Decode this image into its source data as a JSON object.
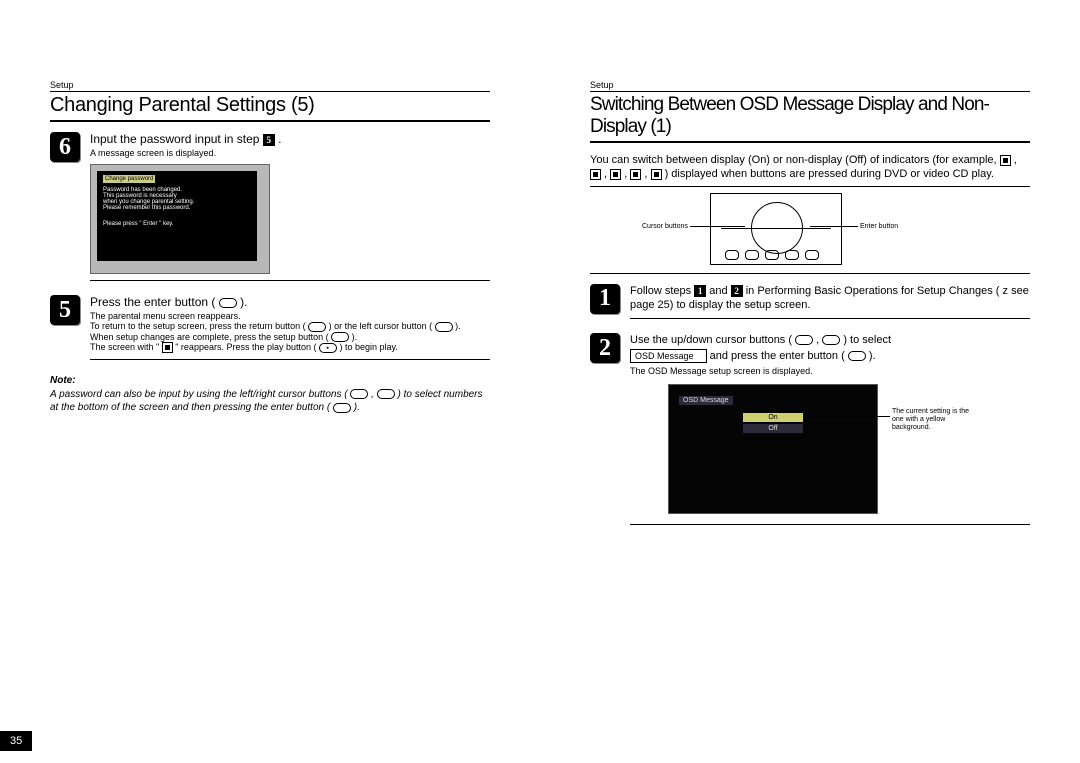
{
  "left": {
    "section": "Setup",
    "title": "Changing Parental Settings (5)",
    "step6": {
      "num": "6",
      "head_a": "Input the password input in step ",
      "badge": "5",
      "head_b": ".",
      "sub": "A message screen is displayed."
    },
    "screen1": {
      "bar": "Change password",
      "line1": "Password has been changed.",
      "line2": "This password is necessary",
      "line3": "when you change parental setting.",
      "line4": "Please remember this password.",
      "line5": "Please press \" Enter \" key."
    },
    "step5": {
      "num": "5",
      "head": "Press the enter button ( ",
      "sub1": "The parental menu screen reappears.",
      "sub2": "To return to the setup screen, press the return button ( ",
      "sub2b": " ) or the left cursor button ( ",
      "sub2c": " ).",
      "sub3": "When setup changes are complete, press the setup button ( ",
      "sub3b": " ).",
      "sub4a": "The screen with \" ",
      "sub4b": " \" reappears. Press the play button ( ",
      "sub4c": " ) to begin play."
    },
    "note": {
      "label": "Note:",
      "body1": "A password can also be input by using the left/right cursor buttons ( ",
      "body2": " , ",
      "body3": " ) to select numbers at the bottom of the screen and then pressing the enter button ( ",
      "body4": " )."
    },
    "page_number": "35"
  },
  "right": {
    "section": "Setup",
    "title": "Switching Between OSD Message Display and Non-Display (1)",
    "intro1": "You can switch between display (On) or non-display (Off) of indicators (for example, ",
    "intro2": ") displayed when buttons are pressed during DVD or video CD play.",
    "remote": {
      "cursor": "Cursor buttons",
      "enter": "Enter button"
    },
    "step1": {
      "num": "1",
      "line_a": "Follow steps ",
      "badge1": "1",
      "line_b": " and ",
      "badge2": "2",
      "line_c": " in  Performing Basic Operations for Setup Changes  ( z    see page 25) to display the setup screen."
    },
    "step2": {
      "num": "2",
      "line_a": "Use the up/down cursor buttons ( ",
      "line_b": " ) to select ",
      "field": "OSD Message",
      "line_c": " and press the enter button ( ",
      "line_d": " ).",
      "sub": "The OSD Message setup screen is displayed."
    },
    "osd": {
      "header": "OSD Message",
      "on": "On",
      "off": "Off",
      "callout": "The current setting is the one with a yellow background."
    }
  }
}
